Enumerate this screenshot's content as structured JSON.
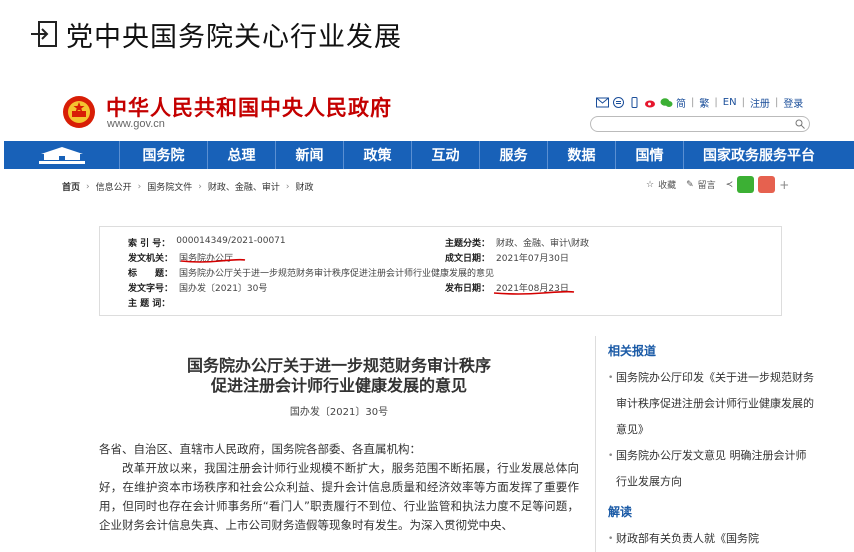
{
  "slide": {
    "title": "党中央国务院关心行业发展"
  },
  "site": {
    "name": "中华人民共和国中央人民政府",
    "url": "www.gov.cn",
    "top_links": [
      "简",
      "繁",
      "EN",
      "注册",
      "登录"
    ],
    "search_placeholder": ""
  },
  "nav": {
    "items": [
      "国务院",
      "总理",
      "新闻",
      "政策",
      "互动",
      "服务",
      "数据",
      "国情",
      "国家政务服务平台"
    ]
  },
  "breadcrumb": [
    "首页",
    "信息公开",
    "国务院文件",
    "财政、金融、审计",
    "财政"
  ],
  "share": {
    "favorite": "收藏",
    "comment": "留言"
  },
  "meta": {
    "index_label": "索 引 号：",
    "index_value": "000014349/2021-00071",
    "agency_label": "发文机关：",
    "agency_value": "国务院办公厅",
    "title_label": "标　　题：",
    "title_value": "国务院办公厅关于进一步规范财务审计秩序促进注册会计师行业健康发展的意见",
    "docno_label": "发文字号：",
    "docno_value": "国办发〔2021〕30号",
    "subject_label": "主 题 词：",
    "subject_value": "",
    "category_label": "主题分类：",
    "category_value": "财政、金融、审计\\财政",
    "created_label": "成文日期：",
    "created_value": "2021年07月30日",
    "published_label": "发布日期：",
    "published_value": "2021年08月23日"
  },
  "doc": {
    "title_line1": "国务院办公厅关于进一步规范财务审计秩序",
    "title_line2": "促进注册会计师行业健康发展的意见",
    "number": "国办发〔2021〕30号",
    "salutation": "各省、自治区、直辖市人民政府，国务院各部委、各直属机构：",
    "para1": "改革开放以来，我国注册会计师行业规模不断扩大，服务范围不断拓展，行业发展总体向好，在维护资本市场秩序和社会公众利益、提升会计信息质量和经济效率等方面发挥了重要作用，但同时也存在会计师事务所“看门人”职责履行不到位、行业监管和执法力度不足等问题，企业财务会计信息失真、上市公司财务造假等现象时有发生。为深入贯彻党中央、"
  },
  "sidebar": {
    "related_heading": "相关报道",
    "related": [
      "国务院办公厅印发《关于进一步规范财务审计秩序促进注册会计师行业健康发展的意见》",
      "国务院办公厅发文意见 明确注册会计师行业发展方向"
    ],
    "interpret_heading": "解读",
    "interpret": [
      "财政部有关负责人就《国务院"
    ]
  },
  "colors": {
    "brand_red": "#c40000",
    "nav_blue": "#1861b8",
    "link_blue": "#1a4e9a",
    "annotation_red": "#d40000"
  }
}
